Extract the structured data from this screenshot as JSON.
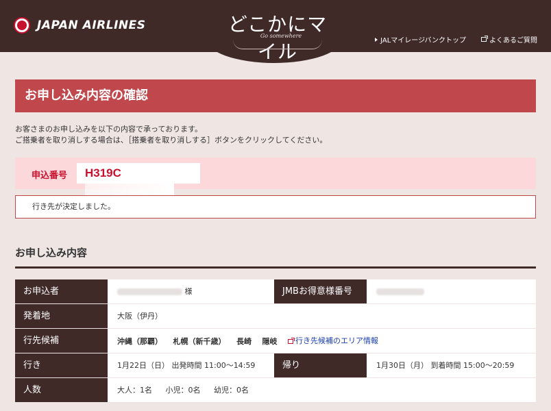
{
  "header": {
    "logo_text": "JAPAN AIRLINES",
    "brand_title": "どこかにマイル",
    "brand_subtitle": "Go somewhere",
    "links": [
      {
        "label": "JALマイレージバンクトップ",
        "icon": "triangle-right-icon"
      },
      {
        "label": "よくあるご質問",
        "icon": "external-link-icon"
      }
    ],
    "bg_color": "#3f2a28"
  },
  "page_title": "お申し込み内容の確認",
  "intro": {
    "line1": "お客さまのお申し込みを以下の内容で承っております。",
    "line2": "ご搭乗者を取り消しする場合は、［搭乗者を取り消しする］ボタンをクリックしてください。"
  },
  "application": {
    "label": "申込番号",
    "value": "H319C"
  },
  "status_message": "行き先が決定しました。",
  "section_title": "お申し込み内容",
  "details": {
    "applicant_label": "お申込者",
    "applicant_suffix": "様",
    "jmb_label": "JMBお得意様番号",
    "origin_label": "発着地",
    "origin_value": "大阪（伊丹）",
    "candidates_label": "行先候補",
    "candidates": [
      "沖縄（那覇）",
      "札幌（新千歳）",
      "長崎",
      "隠岐"
    ],
    "area_link": "行き先候補のエリア情報",
    "outbound_label": "行き",
    "outbound_value": "1月22日（日） 出発時間 11:00～14:59",
    "return_label": "帰り",
    "return_value": "1月30日（月） 到着時間 15:00～20:59",
    "pax_label": "人数",
    "adults": "大人：1名",
    "children": "小児：0名",
    "infants": "幼児：0名"
  },
  "colors": {
    "accent_red": "#c0484c",
    "brand_red": "#c8102e",
    "pink_bg": "#fdd8da",
    "dark_brown": "#3f2a28",
    "link_blue": "#1a3ea8"
  }
}
